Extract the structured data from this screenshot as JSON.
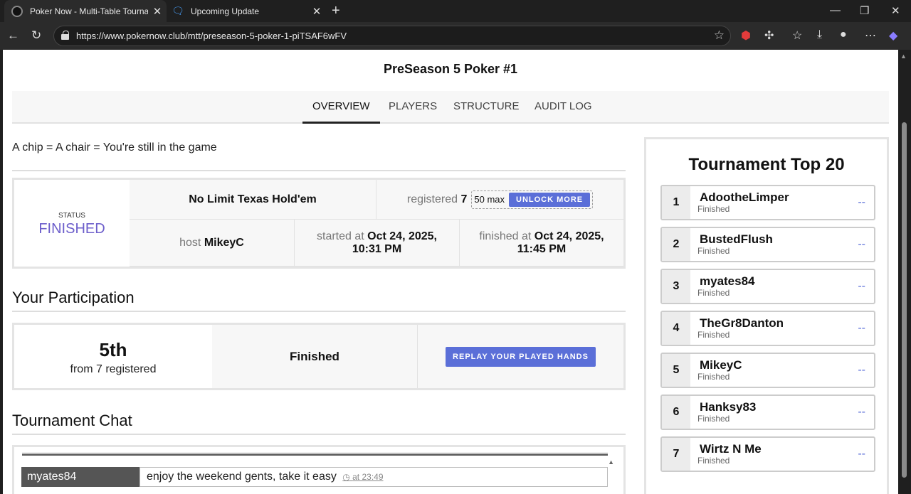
{
  "browser": {
    "tabs": [
      {
        "title": "Poker Now - Multi-Table Tournam",
        "active": true
      },
      {
        "title": "Upcoming Update",
        "active": false
      }
    ],
    "url": "https://www.pokernow.club/mtt/preseason-5-poker-1-piTSAF6wFV"
  },
  "page": {
    "title": "PreSeason 5 Poker #1",
    "tabs": [
      "OVERVIEW",
      "PLAYERS",
      "STRUCTURE",
      "AUDIT LOG"
    ],
    "tagline": "A chip = A chair = You're still in the game"
  },
  "status": {
    "label": "STATUS",
    "value": "FINISHED",
    "game": "No Limit Texas Hold'em",
    "registered_label": "registered",
    "registered_count": "7",
    "max": "50 max",
    "unlock_label": "UNLOCK MORE",
    "host_label": "host",
    "host": "MikeyC",
    "started_label": "started at",
    "started_date": "Oct 24, 2025,",
    "started_time": "10:31 PM",
    "finished_label": "finished at",
    "finished_date": "Oct 24, 2025,",
    "finished_time": "11:45 PM"
  },
  "participation": {
    "heading": "Your Participation",
    "rank": "5th",
    "registered_text": "from 7 registered",
    "state": "Finished",
    "replay_label": "REPLAY YOUR PLAYED HANDS"
  },
  "chat": {
    "heading": "Tournament Chat",
    "messages": [
      {
        "user": "myates84",
        "text": "enjoy the weekend gents, take it easy",
        "time": "at 23:49"
      }
    ]
  },
  "leaderboard": {
    "heading": "Tournament Top 20",
    "rows": [
      {
        "pos": "1",
        "name": "AdootheLimper",
        "status": "Finished",
        "value": "--"
      },
      {
        "pos": "2",
        "name": "BustedFlush",
        "status": "Finished",
        "value": "--"
      },
      {
        "pos": "3",
        "name": "myates84",
        "status": "Finished",
        "value": "--"
      },
      {
        "pos": "4",
        "name": "TheGr8Danton",
        "status": "Finished",
        "value": "--"
      },
      {
        "pos": "5",
        "name": "MikeyC",
        "status": "Finished",
        "value": "--"
      },
      {
        "pos": "6",
        "name": "Hanksy83",
        "status": "Finished",
        "value": "--"
      },
      {
        "pos": "7",
        "name": "Wirtz N Me",
        "status": "Finished",
        "value": "--"
      }
    ]
  }
}
